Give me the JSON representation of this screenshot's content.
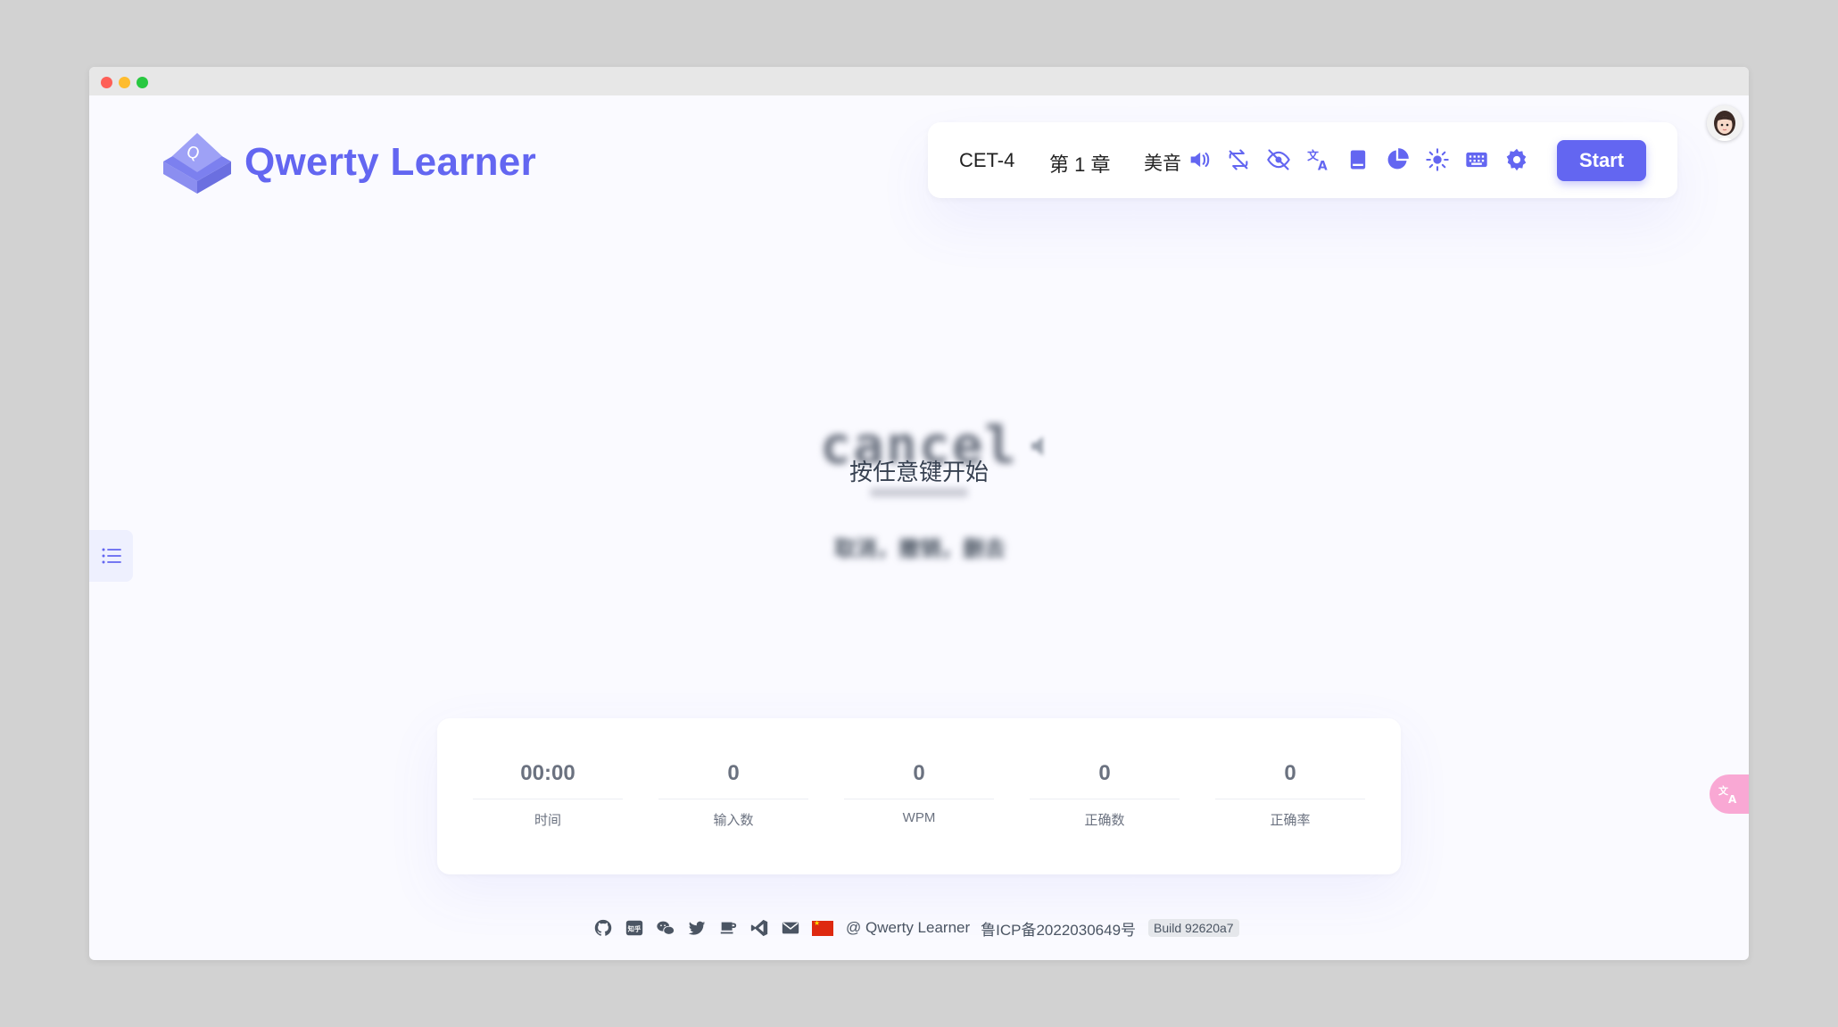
{
  "app": {
    "name": "Qwerty Learner"
  },
  "toolbar": {
    "dictionary": "CET-4",
    "chapter": "第 1 章",
    "accent": "美音",
    "start_label": "Start"
  },
  "word": {
    "text": "cancel",
    "hint": "按任意键开始",
    "translation": "取消，撤销，删去"
  },
  "stats": [
    {
      "value": "00:00",
      "label": "时间"
    },
    {
      "value": "0",
      "label": "输入数"
    },
    {
      "value": "0",
      "label": "WPM"
    },
    {
      "value": "0",
      "label": "正确数"
    },
    {
      "value": "0",
      "label": "正确率"
    }
  ],
  "footer": {
    "copyright": "@ Qwerty Learner",
    "icp": "鲁ICP备2022030649号",
    "build": "Build 92620a7"
  },
  "colors": {
    "accent": "#6366f1",
    "background": "#fafaff",
    "float_translate": "#f9a8d4"
  }
}
